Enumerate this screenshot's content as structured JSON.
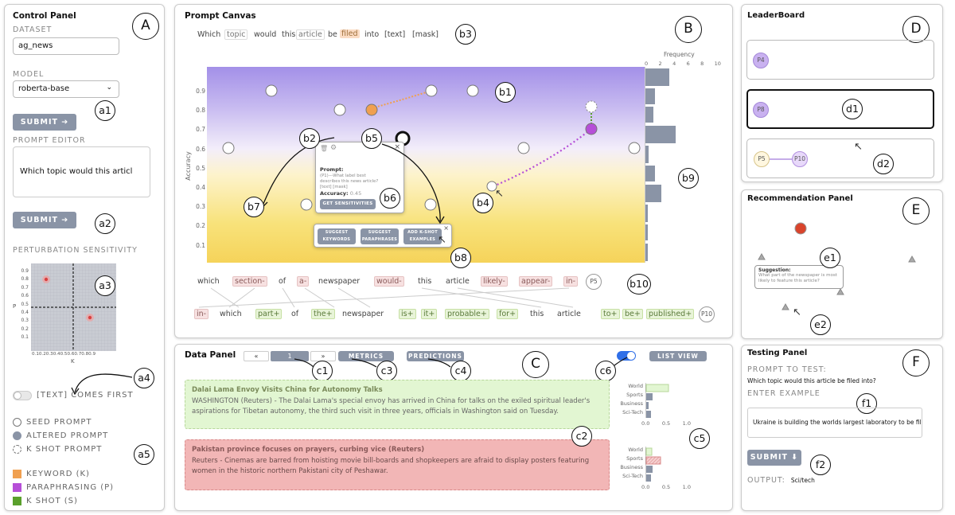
{
  "control_panel": {
    "title": "Control Panel",
    "badge": "A",
    "dataset_label": "DATASET",
    "dataset_value": "ag_news",
    "model_label": "MODEL",
    "model_value": "roberta-base",
    "submit1": "SUBMIT ➔",
    "submit2": "SUBMIT ➔",
    "prompt_editor_label": "PROMPT EDITOR",
    "prompt_editor_value": "Which topic would this articl",
    "perturbation_label": "PERTURBATION SENSITIVITY",
    "sens_ylabel": "P",
    "sens_xlabel": "K",
    "sens_yticks": [
      "0.9",
      "0.8",
      "0.7",
      "0.6",
      "0.5",
      "0.4",
      "0.3",
      "0.2",
      "0.1"
    ],
    "sens_xticks": "0.10.20.30.40.50.60.70.80.9",
    "toggle_label": "[TEXT] COMES FIRST",
    "legend": [
      "SEED PROMPT",
      "ALTERED PROMPT",
      "K SHOT PROMPT",
      "KEYWORD (K)",
      "PARAPHRASING (P)",
      "K SHOT (S)"
    ],
    "annotations": {
      "a1": "a1",
      "a2": "a2",
      "a3": "a3",
      "a4": "a4",
      "a5": "a5"
    }
  },
  "prompt_canvas": {
    "title": "Prompt Canvas",
    "badge": "B",
    "prompt_tokens": [
      "Which",
      "topic",
      "would",
      "this",
      "article",
      "be",
      "filed",
      "into",
      "[text]",
      "[mask]"
    ],
    "ylabel": "Accuracy",
    "yticks": [
      "0.9",
      "0.8",
      "0.7",
      "0.6",
      "0.5",
      "0.4",
      "0.3",
      "0.2",
      "0.1"
    ],
    "hist_title": "Frequency",
    "hist_ticks": [
      "0",
      "2",
      "4",
      "6",
      "8",
      "10"
    ],
    "popup": {
      "prompt_label": "Prompt:",
      "prompt_text": "(P1)---What label best describes this news article?[text] [mask]",
      "accuracy_label": "Accuracy:",
      "accuracy_value": "0.45",
      "button": "GET SENSITIVITIES"
    },
    "suggest": {
      "keywords": "SUGGEST KEYWORDS",
      "paraphrases": "SUGGEST PARAPHRASES",
      "kshot": "ADD K-SHOT EXAMPLES"
    },
    "row1": [
      "which",
      "section-",
      "of",
      "a-",
      "newspaper",
      "would-",
      "this",
      "article",
      "likely-",
      "appear-",
      "in-"
    ],
    "row1_id": "P5",
    "row2": [
      "in-",
      "which",
      "part+",
      "of",
      "the+",
      "newspaper",
      "is+",
      "it+",
      "probable+",
      "for+",
      "this",
      "article",
      "to+",
      "be+",
      "published+"
    ],
    "row2_id": "P10",
    "annotations": {
      "b1": "b1",
      "b2": "b2",
      "b3": "b3",
      "b4": "b4",
      "b5": "b5",
      "b6": "b6",
      "b7": "b7",
      "b8": "b8",
      "b9": "b9",
      "b10": "b10"
    }
  },
  "data_panel": {
    "title": "Data Panel",
    "badge": "C",
    "page_prev": "«",
    "page_num": "1",
    "page_next": "»",
    "metrics": "METRICS",
    "predictions": "PREDICTIONS",
    "list_view": "LIST VIEW",
    "cards": [
      {
        "title": "Dalai Lama Envoy Visits China for Autonomy Talks",
        "body": "WASHINGTON (Reuters) - The Dalai Lama's special envoy has arrived in China for talks on the exiled spiritual leader's aspirations for Tibetan autonomy, the third such visit in three years, officials in Washington said on Tuesday."
      },
      {
        "title": "Pakistan province focuses on prayers, curbing vice (Reuters)",
        "body": "Reuters - Cinemas are barred from hoisting movie bill-boards and shopkeepers are afraid to display posters featuring women in the historic northern Pakistani city of Peshawar."
      }
    ],
    "mini_categories": [
      "World",
      "Sports",
      "Business",
      "Sci-Tech"
    ],
    "mini_ticks": [
      "0.0",
      "0.5",
      "1.0"
    ],
    "annotations": {
      "c1": "c1",
      "c2": "c2",
      "c3": "c3",
      "c4": "c4",
      "c5": "c5",
      "c6": "c6"
    }
  },
  "leaderboard": {
    "title": "LeaderBoard",
    "badge": "D",
    "p4": "P4",
    "p8": "P8",
    "p5": "P5",
    "p10": "P10",
    "annotations": {
      "d1": "d1",
      "d2": "d2"
    }
  },
  "recommendation": {
    "title": "Recommendation Panel",
    "badge": "E",
    "suggestion_label": "Suggestion:",
    "suggestion_text": "What part of the newspaper is most likely to feature this article?",
    "annotations": {
      "e1": "e1",
      "e2": "e2"
    }
  },
  "testing": {
    "title": "Testing Panel",
    "badge": "F",
    "prompt_label": "PROMPT TO TEST:",
    "prompt_value": "Which topic would this article be filed into?",
    "example_label": "ENTER EXAMPLE",
    "example_value": "Ukraine is building the worlds largest laboratory to be fillec",
    "submit": "SUBMIT ⬇",
    "output_label": "OUTPUT:",
    "output_value": "Sci/tech",
    "annotations": {
      "f1": "f1",
      "f2": "f2"
    }
  },
  "colors": {
    "keyword": "#f0a050",
    "paraphrasing": "#b64fd8",
    "kshot": "#5aa02c",
    "button": "#8a94a6",
    "toggle_on": "#2f6fe8"
  }
}
